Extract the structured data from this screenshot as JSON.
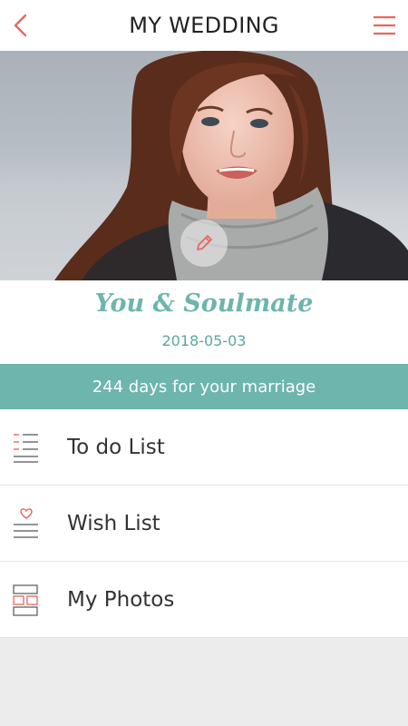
{
  "header": {
    "title": "MY WEDDING",
    "back_icon": "chevron-left-icon",
    "menu_icon": "hamburger-menu-icon"
  },
  "cover": {
    "edit_icon": "pencil-icon"
  },
  "couple": {
    "names": "You & Soulmate",
    "date": "2018-05-03"
  },
  "countdown": {
    "text": "244 days for your marriage"
  },
  "menu": {
    "items": [
      {
        "label": "To do List",
        "icon": "checklist-icon"
      },
      {
        "label": "Wish List",
        "icon": "heart-list-icon"
      },
      {
        "label": "My Photos",
        "icon": "photo-grid-icon"
      }
    ]
  },
  "colors": {
    "accent": "#6db5ad",
    "icon_red": "#e8665f",
    "header_bg": "#ffffff",
    "page_bg": "#ececec"
  }
}
